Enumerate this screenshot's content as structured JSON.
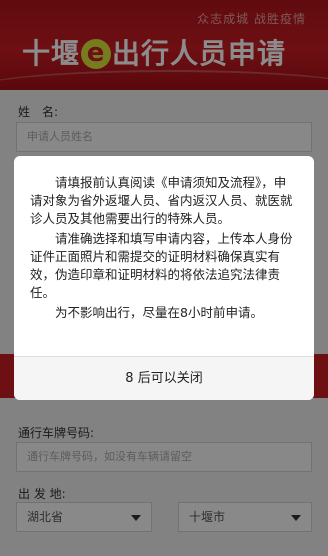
{
  "banner": {
    "slogan": "众志成城 战胜疫情",
    "title_pre": "十堰",
    "title_e": "e",
    "title_post": "出行人员申请"
  },
  "form": {
    "name_label": "姓　名:",
    "name_placeholder": "申请人员姓名",
    "plate_label": "通行车牌号码:",
    "plate_placeholder": "通行车牌号码，如没有车辆请留空",
    "origin_label": "出 发 地:",
    "province_value": "湖北省",
    "city_value": "十堰市"
  },
  "modal": {
    "paragraphs": [
      "请填报前认真阅读《申请须知及流程》，申请对象为省外返堰人员、省内返汉人员、就医就诊人员及其他需要出行的特殊人员。",
      "请准确选择和填写申请内容，上传本人身份证件正面照片和需提交的证明材料确保真实有效，伪造印章和证明材料的将依法追究法律责任。",
      "为不影响出行，尽量在8小时前申请。"
    ],
    "close_button": "8 后可以关闭"
  }
}
